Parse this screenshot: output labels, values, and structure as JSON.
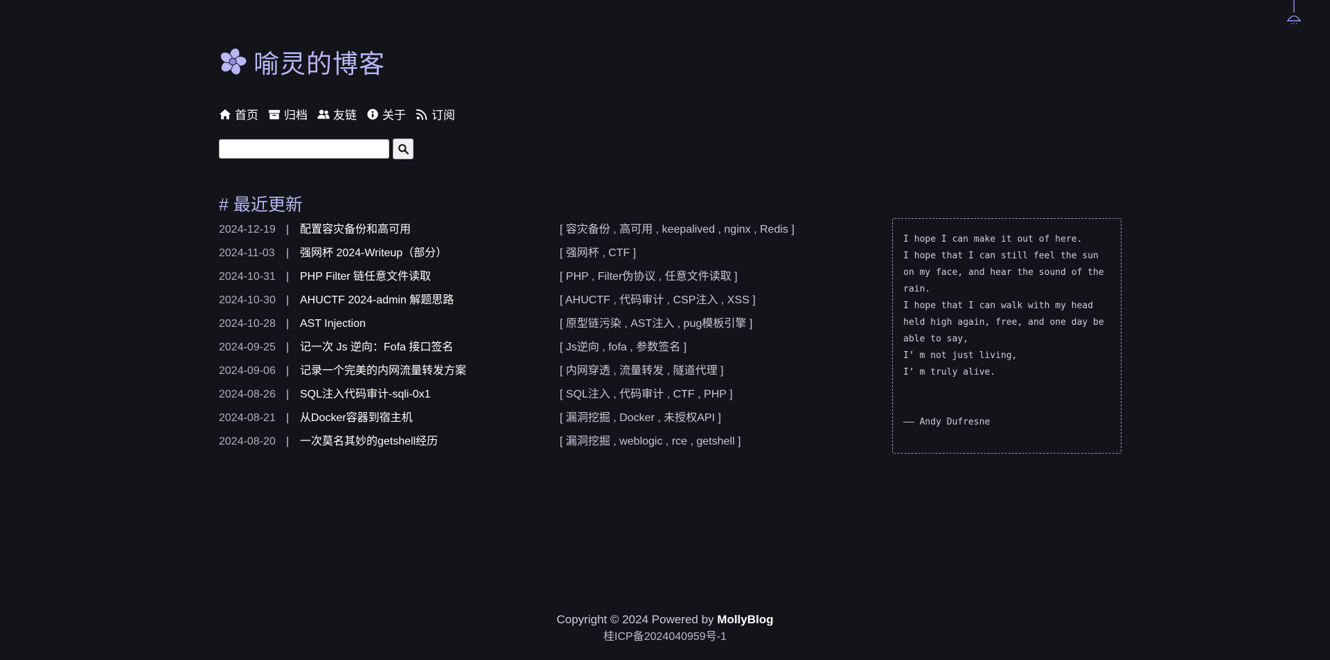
{
  "site": {
    "title": "喻灵的博客",
    "logo_icon": "flower-logo-icon",
    "accent_color": "#b9b7f5",
    "background_color": "#13131a"
  },
  "nav": {
    "items": [
      {
        "label": "首页",
        "icon": "home-icon"
      },
      {
        "label": "归档",
        "icon": "archive-icon"
      },
      {
        "label": "友链",
        "icon": "users-icon"
      },
      {
        "label": "关于",
        "icon": "info-icon"
      },
      {
        "label": "订阅",
        "icon": "rss-icon"
      }
    ]
  },
  "search": {
    "value": "",
    "button_icon": "search-icon"
  },
  "recent": {
    "heading": "# 最近更新",
    "separator": "|",
    "posts": [
      {
        "date": "2024-12-19",
        "title": "配置容灾备份和高可用",
        "tags": "[ 容灾备份 , 高可用 , keepalived , nginx , Redis ]"
      },
      {
        "date": "2024-11-03",
        "title": "强网杯 2024-Writeup（部分）",
        "tags": "[ 强网杯 , CTF ]"
      },
      {
        "date": "2024-10-31",
        "title": "PHP Filter 链任意文件读取",
        "tags": "[ PHP , Filter伪协议 , 任意文件读取 ]"
      },
      {
        "date": "2024-10-30",
        "title": "AHUCTF 2024-admin 解题思路",
        "tags": "[ AHUCTF , 代码审计 , CSP注入 , XSS ]"
      },
      {
        "date": "2024-10-28",
        "title": "AST Injection",
        "tags": "[ 原型链污染 , AST注入 , pug模板引擎 ]"
      },
      {
        "date": "2024-09-25",
        "title": "记一次 Js 逆向：Fofa 接口签名",
        "tags": "[ Js逆向 , fofa , 参数签名 ]"
      },
      {
        "date": "2024-09-06",
        "title": "记录一个完美的内网流量转发方案",
        "tags": "[ 内网穿透 , 流量转发 , 隧道代理 ]"
      },
      {
        "date": "2024-08-26",
        "title": "SQL注入代码审计-sqli-0x1",
        "tags": "[ SQL注入 , 代码审计 , CTF , PHP ]"
      },
      {
        "date": "2024-08-21",
        "title": "从Docker容器到宿主机",
        "tags": "[ 漏洞挖掘 , Docker , 未授权API ]"
      },
      {
        "date": "2024-08-20",
        "title": "一次莫名其妙的getshell经历",
        "tags": "[ 漏洞挖掘 , weblogic , rce , getshell ]"
      }
    ]
  },
  "quote": {
    "lines": [
      "I hope I can make it out of here.",
      "I hope that I can still feel the sun on my face, and hear the sound of the rain.",
      "I hope that I can walk with my head held high again, free, and one day be able to say,",
      "I’ m not just living,",
      "I’ m truly alive."
    ],
    "author": "—— Andy Dufresne"
  },
  "footer": {
    "copyright": "Copyright © 2024 Powered by ",
    "brand": "MollyBlog",
    "icp": "桂ICP备2024040959号-1"
  },
  "decor": {
    "top_right_icon": "hanging-lamp-icon"
  }
}
